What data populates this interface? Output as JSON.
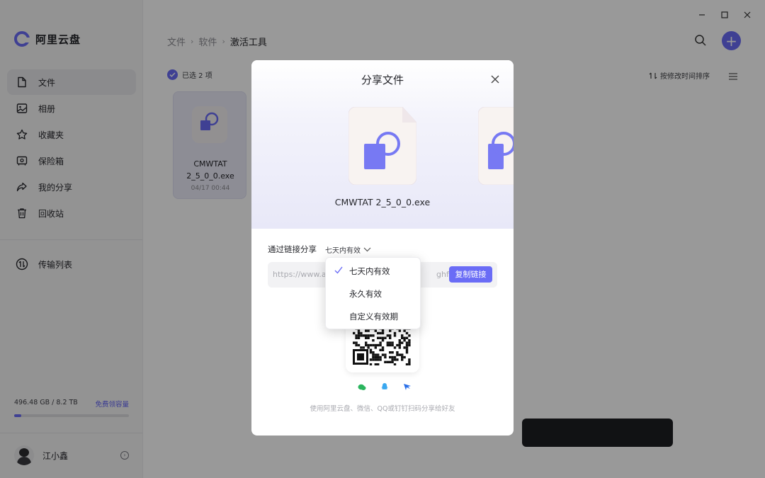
{
  "app": {
    "title": "阿里云盘",
    "window_controls": [
      "minimize",
      "maximize",
      "close"
    ]
  },
  "sidebar": {
    "items": [
      {
        "label": "文件",
        "icon": "file-icon",
        "active": true
      },
      {
        "label": "相册",
        "icon": "photo-icon",
        "active": false
      },
      {
        "label": "收藏夹",
        "icon": "star-icon",
        "active": false
      },
      {
        "label": "保险箱",
        "icon": "safe-icon",
        "active": false
      },
      {
        "label": "我的分享",
        "icon": "share-icon",
        "active": false
      },
      {
        "label": "回收站",
        "icon": "trash-icon",
        "active": false
      }
    ],
    "transfer": {
      "label": "传输列表",
      "icon": "transfer-icon"
    },
    "storage": {
      "used_text": "496.48 GB / 8.2 TB",
      "link": "免费领容量",
      "fraction": 0.06
    },
    "user": {
      "name": "江小鑫"
    }
  },
  "header": {
    "breadcrumb": [
      "文件",
      "软件",
      "激活工具"
    ],
    "selected_text": "已选 2 项",
    "sort_label": "按修改时间排序",
    "accent": "#6a6cf6"
  },
  "file_card": {
    "name_line1": "CMWTAT",
    "name_line2": "2_5_0_0.exe",
    "date": "04/17 00:44"
  },
  "modal": {
    "title": "分享文件",
    "file_name": "CMWTAT 2_5_0_0.exe",
    "share_label": "通过链接分享",
    "validity_selected": "七天内有效",
    "link_prefix": "https://www.al",
    "link_suffix": "ghfM",
    "copy_button": "复制链接",
    "hint": "使用阿里云盘、微信、QQ或钉钉扫码分享给好友",
    "share_apps": [
      {
        "name": "wechat-icon",
        "color": "#2bb55e"
      },
      {
        "name": "qq-icon",
        "color": "#3aa8f0"
      },
      {
        "name": "dingtalk-icon",
        "color": "#2a6fe8"
      }
    ]
  },
  "dropdown": {
    "options": [
      {
        "label": "七天内有效",
        "checked": true
      },
      {
        "label": "永久有效",
        "checked": false
      },
      {
        "label": "自定义有效期",
        "checked": false
      }
    ]
  }
}
